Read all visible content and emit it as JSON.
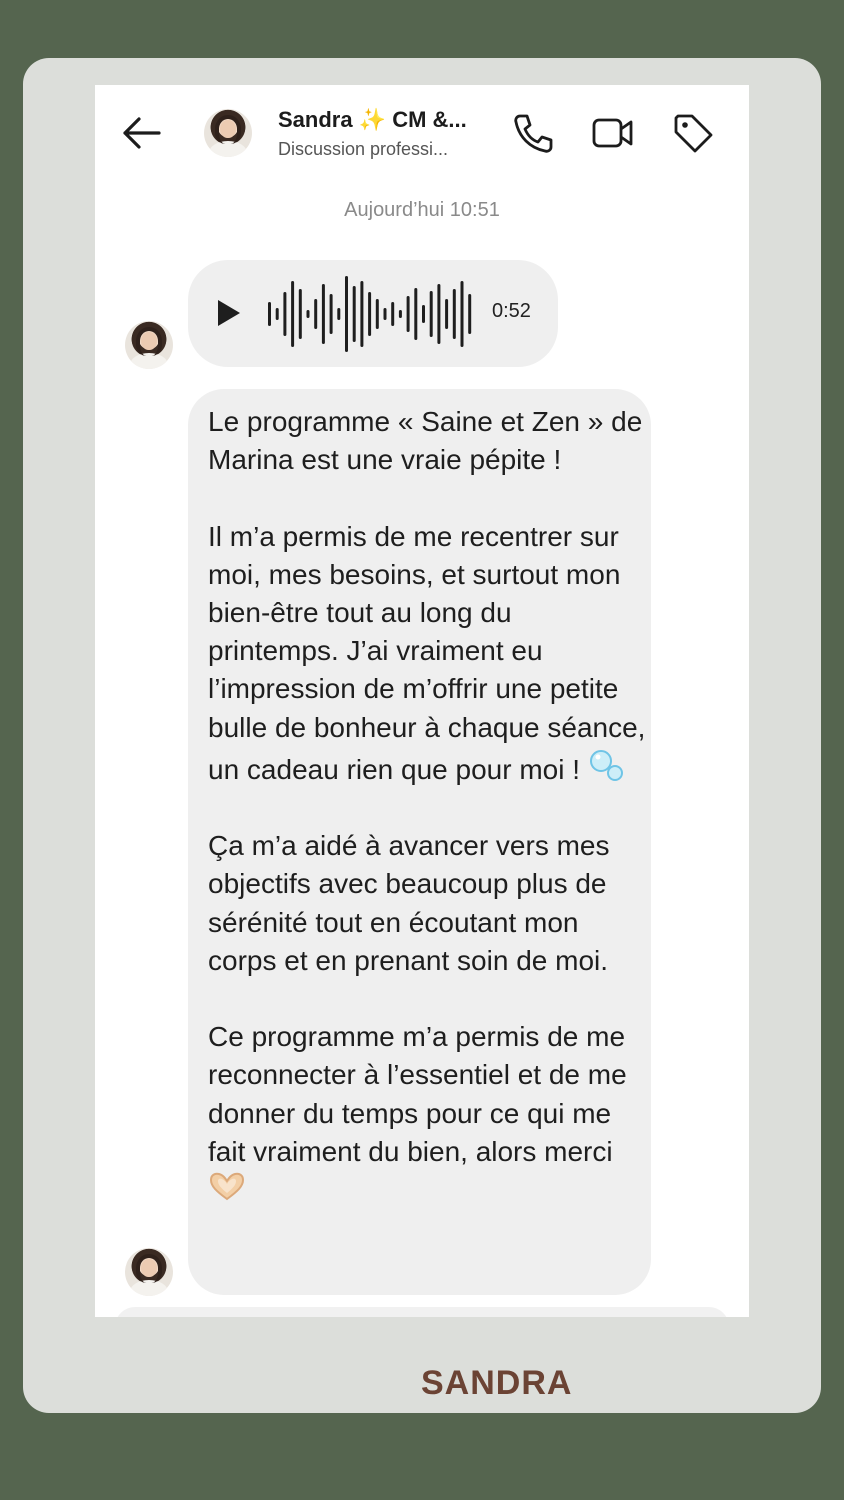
{
  "header": {
    "contact_name": "Sandra ✨ CM &...",
    "contact_subtitle": "Discussion professi..."
  },
  "icons": {
    "back": "arrow-left-icon",
    "call": "phone-icon",
    "video": "video-camera-icon",
    "label": "tag-icon",
    "play": "play-icon",
    "bubbles": "bubbles-emoji",
    "heart_hands": "heart-hands-emoji"
  },
  "conversation": {
    "timestamp": "Aujourd’hui 10:51",
    "audio_message": {
      "duration": "0:52"
    },
    "text_message": {
      "paragraph_1": "Le programme « Saine et Zen » de Marina est une vraie pépite !",
      "paragraph_2": "Il m’a permis de me recentrer sur moi, mes besoins, et surtout mon bien-être tout au long du printemps. J’ai vraiment eu l’impression de m’offrir une petite bulle de bonheur à chaque séance, un cadeau rien que pour moi !",
      "paragraph_3": "Ça m’a aidé à avancer vers mes objectifs avec beaucoup plus de sérénité tout en écoutant mon corps et en prenant soin de moi.",
      "paragraph_4": "Ce programme m’a permis de me reconnecter à l’essentiel et de me donner du temps pour ce qui me fait vraiment du bien, alors merci"
    }
  },
  "caption": "SANDRA",
  "colors": {
    "page_background": "#55654f",
    "card_background": "#dcdeda",
    "bubble_background": "#efefef",
    "caption_color": "#6b4334"
  }
}
